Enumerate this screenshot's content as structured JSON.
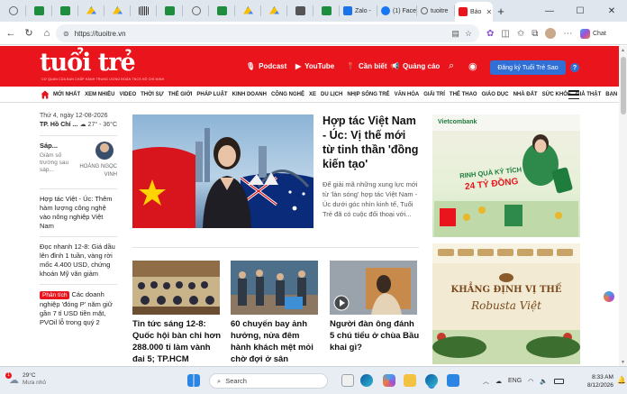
{
  "browser": {
    "tabs": [
      {
        "label": "Zalo - ",
        "color": "#1a73e8"
      },
      {
        "label": "(1) Face",
        "color": "#1877f2"
      },
      {
        "label": "tuoitre",
        "color": "#6b6b6b"
      },
      {
        "label": "Báo",
        "color": "#e9141c",
        "active": true
      }
    ],
    "new_tab": "+",
    "url": "https://tuoitre.vn",
    "chat_label": "Chat"
  },
  "site": {
    "logo": "tuổi trẻ",
    "tagline": "CƠ QUAN CỦA BAN CHẤP HÀNH TRUNG ƯƠNG ĐOÀN TNCS HỒ CHÍ MINH",
    "header_links": [
      {
        "label": "Podcast",
        "icon": "microphone-icon"
      },
      {
        "label": "YouTube",
        "icon": "play-icon"
      },
      {
        "label": "Cần biết",
        "icon": "pin-icon"
      },
      {
        "label": "Quảng cáo",
        "icon": "megaphone-icon"
      }
    ],
    "subscribe_label": "Đăng ký Tuổi Trẻ Sao",
    "help_label": "?",
    "categories": [
      "MỚI NHẤT",
      "XEM NHIỀU",
      "VIDEO",
      "THỜI SỰ",
      "THẾ GIỚI",
      "PHÁP LUẬT",
      "KINH DOANH",
      "CÔNG NGHỆ",
      "XE",
      "DU LỊCH",
      "NHỊP SỐNG TRẺ",
      "VĂN HÓA",
      "GIẢI TRÍ",
      "THỂ THAO",
      "GIÁO DỤC",
      "NHÀ ĐẤT",
      "SỨC KHỎE",
      "GIẢ THẬT",
      "BẠN ĐỌC"
    ]
  },
  "left": {
    "date": "Thứ 4, ngày 12-08-2026",
    "city": "TP. Hồ Chí ...",
    "temp": "27° - 36°C",
    "author_section": "Sáp...",
    "author_snippet": "Giảm số trường sau sáp...",
    "author_name": "HOÀNG NGỌC VINH",
    "news": [
      {
        "text": "Hợp tác Việt - Úc: Thêm hàm lượng công nghệ vào nông nghiệp Việt Nam"
      },
      {
        "text": "Đọc nhanh 12-8: Giá dầu lên đỉnh 1 tuần, vàng rời mốc 4.400 USD, chứng khoán Mỹ văn giảm"
      },
      {
        "badge": "Phân tích",
        "text": "Các doanh nghiệp 'đóng P' năm giữ gần 7 tỉ USD tiền mặt, PVOil lỗ trong quý 2"
      }
    ]
  },
  "main": {
    "feature_title": "Hợp tác Việt Nam - Úc: Vị thế mới từ tinh thần 'đồng kiến tạo'",
    "feature_sapo": "Để giải mã những xung lực mới từ 'làn sóng' hợp tác Việt Nam - Úc dưới góc nhìn kinh tế, Tuổi Trẻ đã có cuộc đối thoại với...",
    "cards": [
      {
        "title": "Tin tức sáng 12-8: Quốc hội bàn chi hơn 288.000 tỉ làm vành đai 5; TP.HCM"
      },
      {
        "title": "60 chuyến bay ảnh hưởng, nửa đêm hành khách mệt mỏi chờ đợi ở sân"
      },
      {
        "title": "Người đàn ông đánh 5 chú tiểu ở chùa Bầu khai gì?"
      }
    ]
  },
  "ads": {
    "ad1_brand": "Vietcombank",
    "ad1_headline": "RINH QUÀ KỶ TÍCH",
    "ad1_amount": "24 TỶ ĐỒNG",
    "ad2_headline": "KHẲNG ĐỊNH VỊ THẾ",
    "ad2_sub": "Robusta Việt"
  },
  "taskbar": {
    "temp": "29°C",
    "condition": "Mưa nhỏ",
    "search_placeholder": "Search",
    "lang": "ENG",
    "time": "8:33 AM",
    "date": "8/12/2026",
    "notif": "1"
  },
  "colors": {
    "brand": "#e9141c",
    "blue": "#2f6fd6"
  }
}
